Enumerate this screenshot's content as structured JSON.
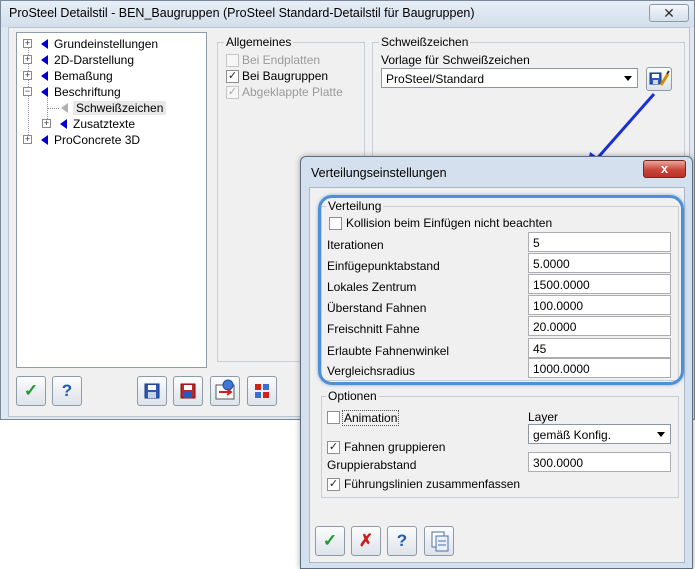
{
  "main_window": {
    "title": "ProSteel Detailstil - BEN_Baugruppen (ProSteel Standard-Detailstil für Baugruppen)",
    "close_glyph": "✕"
  },
  "tree": {
    "items": [
      {
        "label": "Grundeinstellungen"
      },
      {
        "label": "2D-Darstellung"
      },
      {
        "label": "Bemaßung"
      },
      {
        "label": "Beschriftung"
      },
      {
        "label": "Schweißzeichen"
      },
      {
        "label": "Zusatztexte"
      },
      {
        "label": "ProConcrete 3D"
      }
    ]
  },
  "allgemeines": {
    "title": "Allgemeines",
    "options": [
      {
        "label": "Bei Endplatten",
        "checked": false,
        "disabled": true
      },
      {
        "label": "Bei Baugruppen",
        "checked": true,
        "disabled": false
      },
      {
        "label": "Abgeklappte Platte",
        "checked": true,
        "disabled": true
      }
    ]
  },
  "schweisszeichen": {
    "title": "Schweißzeichen",
    "vorlage_label": "Vorlage für Schweißzeichen",
    "vorlage_value": "ProSteel/Standard"
  },
  "dialog": {
    "title": "Verteilungseinstellungen",
    "close_glyph": "x",
    "verteilung": {
      "title": "Verteilung",
      "kollision_label": "Kollision beim Einfügen nicht beachten",
      "fields": [
        {
          "label": "Iterationen",
          "value": "5"
        },
        {
          "label": "Einfügepunktabstand",
          "value": "5.0000"
        },
        {
          "label": "Lokales Zentrum",
          "value": "1500.0000"
        },
        {
          "label": "Überstand Fahnen",
          "value": "100.0000"
        },
        {
          "label": "Freischnitt Fahne",
          "value": "20.0000"
        },
        {
          "label": "Erlaubte Fahnenwinkel",
          "value": "45"
        },
        {
          "label": "Vergleichsradius",
          "value": "1000.0000"
        }
      ]
    },
    "optionen": {
      "title": "Optionen",
      "animation_label": "Animation",
      "layer_label": "Layer",
      "layer_value": "gemäß Konfig.",
      "fahnen_label": "Fahnen gruppieren",
      "gruppierabstand_label": "Gruppierabstand",
      "gruppierabstand_value": "300.0000",
      "fuehrung_label": "Führungslinien zusammenfassen"
    }
  },
  "colors": {
    "annotation_arrow": "#1a2fd6",
    "highlight": "#4f8fd6"
  }
}
